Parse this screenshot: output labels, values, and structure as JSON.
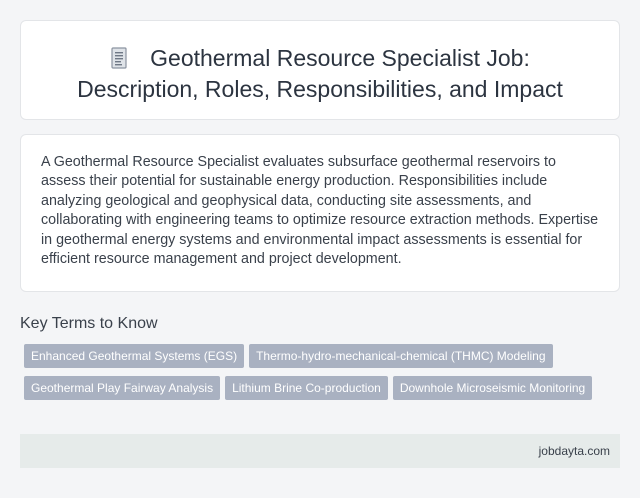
{
  "header": {
    "icon": "document-icon",
    "title": "Geothermal Resource Specialist Job: Description, Roles, Responsibilities, and Impact"
  },
  "description": "A Geothermal Resource Specialist evaluates subsurface geothermal reservoirs to assess their potential for sustainable energy production. Responsibilities include analyzing geological and geophysical data, conducting site assessments, and collaborating with engineering teams to optimize resource extraction methods. Expertise in geothermal energy systems and environmental impact assessments is essential for efficient resource management and project development.",
  "key_terms": {
    "heading": "Key Terms to Know",
    "rows": [
      [
        "Enhanced Geothermal Systems (EGS)",
        "Thermo-hydro-mechanical-chemical (THMC) Modeling"
      ],
      [
        "Geothermal Play Fairway Analysis",
        "Lithium Brine Co-production",
        "Downhole Microseismic Monitoring"
      ]
    ]
  },
  "footer": {
    "site": "jobdayta.com"
  },
  "colors": {
    "tag_background": "#a9b1c1",
    "footer_background": "#e6ebea",
    "page_background": "#f4f5f7"
  }
}
